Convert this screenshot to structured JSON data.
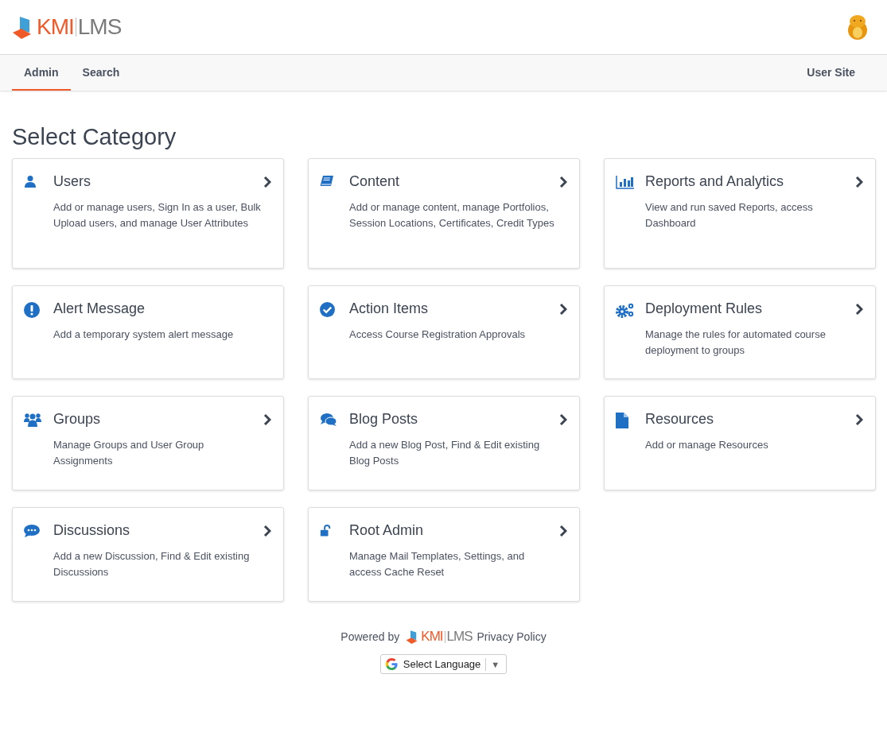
{
  "header": {
    "logo": {
      "left": "KMI",
      "right": "LMS"
    }
  },
  "nav": {
    "tabs": [
      {
        "label": "Admin",
        "selected": true
      },
      {
        "label": "Search",
        "selected": false
      }
    ],
    "right_link": "User Site"
  },
  "page_title": "Select Category",
  "cards": [
    {
      "kind": "user",
      "title": "Users",
      "description": "Add or manage users, Sign In as a user, Bulk Upload users, and manage User Attributes",
      "arrow": true
    },
    {
      "kind": "book",
      "title": "Content",
      "description": "Add or manage content, manage Portfolios, Session Locations, Certificates, Credit Types",
      "arrow": true
    },
    {
      "kind": "chart",
      "title": "Reports and Analytics",
      "description": "View and run saved Reports, access Dashboard",
      "arrow": true
    },
    {
      "kind": "alert",
      "title": "Alert Message",
      "description": "Add a temporary system alert message",
      "arrow": false
    },
    {
      "kind": "check",
      "title": "Action Items",
      "description": "Access Course Registration Approvals",
      "arrow": true
    },
    {
      "kind": "gears",
      "title": "Deployment Rules",
      "description": "Manage the rules for automated course deployment to groups",
      "arrow": true
    },
    {
      "kind": "group",
      "title": "Groups",
      "description": "Manage Groups and User Group Assignments",
      "arrow": true
    },
    {
      "kind": "comments",
      "title": "Blog Posts",
      "description": "Add a new Blog Post, Find & Edit existing Blog Posts",
      "arrow": true
    },
    {
      "kind": "file",
      "title": "Resources",
      "description": "Add or manage Resources",
      "arrow": true
    },
    {
      "kind": "comment",
      "title": "Discussions",
      "description": "Add a new Discussion, Find & Edit existing Discussions",
      "arrow": true
    },
    {
      "kind": "unlock",
      "title": "Root Admin",
      "description": "Manage Mail Templates, Settings, and access Cache Reset",
      "arrow": true
    }
  ],
  "footer": {
    "powered_by": "Powered by",
    "logo": {
      "left": "KMI",
      "right": "LMS"
    },
    "privacy_link": "Privacy Policy",
    "language_select": {
      "label": "Select Language",
      "caret": "▼"
    }
  }
}
